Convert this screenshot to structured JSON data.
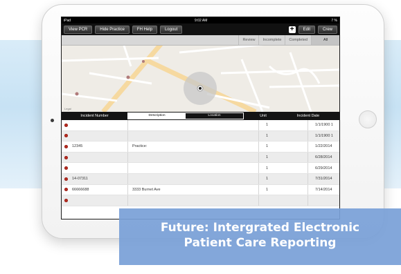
{
  "status_bar": {
    "device": "iPad",
    "time": "9:02 AM",
    "battery": "7 % "
  },
  "toolbar": {
    "left_buttons": [
      "View PCR",
      "Hide Practice",
      "FH Help",
      "Logout"
    ],
    "add_symbol": "+",
    "right_buttons": [
      "Edit",
      "Crew"
    ]
  },
  "filters": {
    "tabs": [
      "Review",
      "Incomplete",
      "Completed",
      "All"
    ],
    "selected": "All"
  },
  "map": {
    "legal_label": "Legal"
  },
  "list": {
    "headers": {
      "number": "Incident Number",
      "unit": "Unit",
      "date": "Incident Date"
    },
    "segment": {
      "options": [
        "Description",
        "Location"
      ],
      "selected": "Description"
    },
    "rows": [
      {
        "number": "",
        "description": "",
        "unit": "1",
        "date": "1/1/1900 1"
      },
      {
        "number": "",
        "description": "",
        "unit": "1",
        "date": "1/1/1900 1"
      },
      {
        "number": "12345",
        "description": "Practice:",
        "unit": "1",
        "date": "1/22/2014"
      },
      {
        "number": "",
        "description": "",
        "unit": "1",
        "date": "6/28/2014"
      },
      {
        "number": "",
        "description": "",
        "unit": "1",
        "date": "6/29/2014"
      },
      {
        "number": "14-07311",
        "description": "",
        "unit": "1",
        "date": "7/31/2014"
      },
      {
        "number": "66666688",
        "description": "3333 Burnet Ave",
        "unit": "1",
        "date": "7/14/2014"
      },
      {
        "number": "",
        "description": "",
        "unit": "",
        "date": ""
      }
    ]
  },
  "caption": {
    "line1": "Future: Intergrated Electronic",
    "line2": "Patient Care Reporting"
  },
  "colors": {
    "status_dot": "#b52a1f",
    "caption_bg": "#7aa0d7",
    "toolbar_bg": "#111111"
  }
}
